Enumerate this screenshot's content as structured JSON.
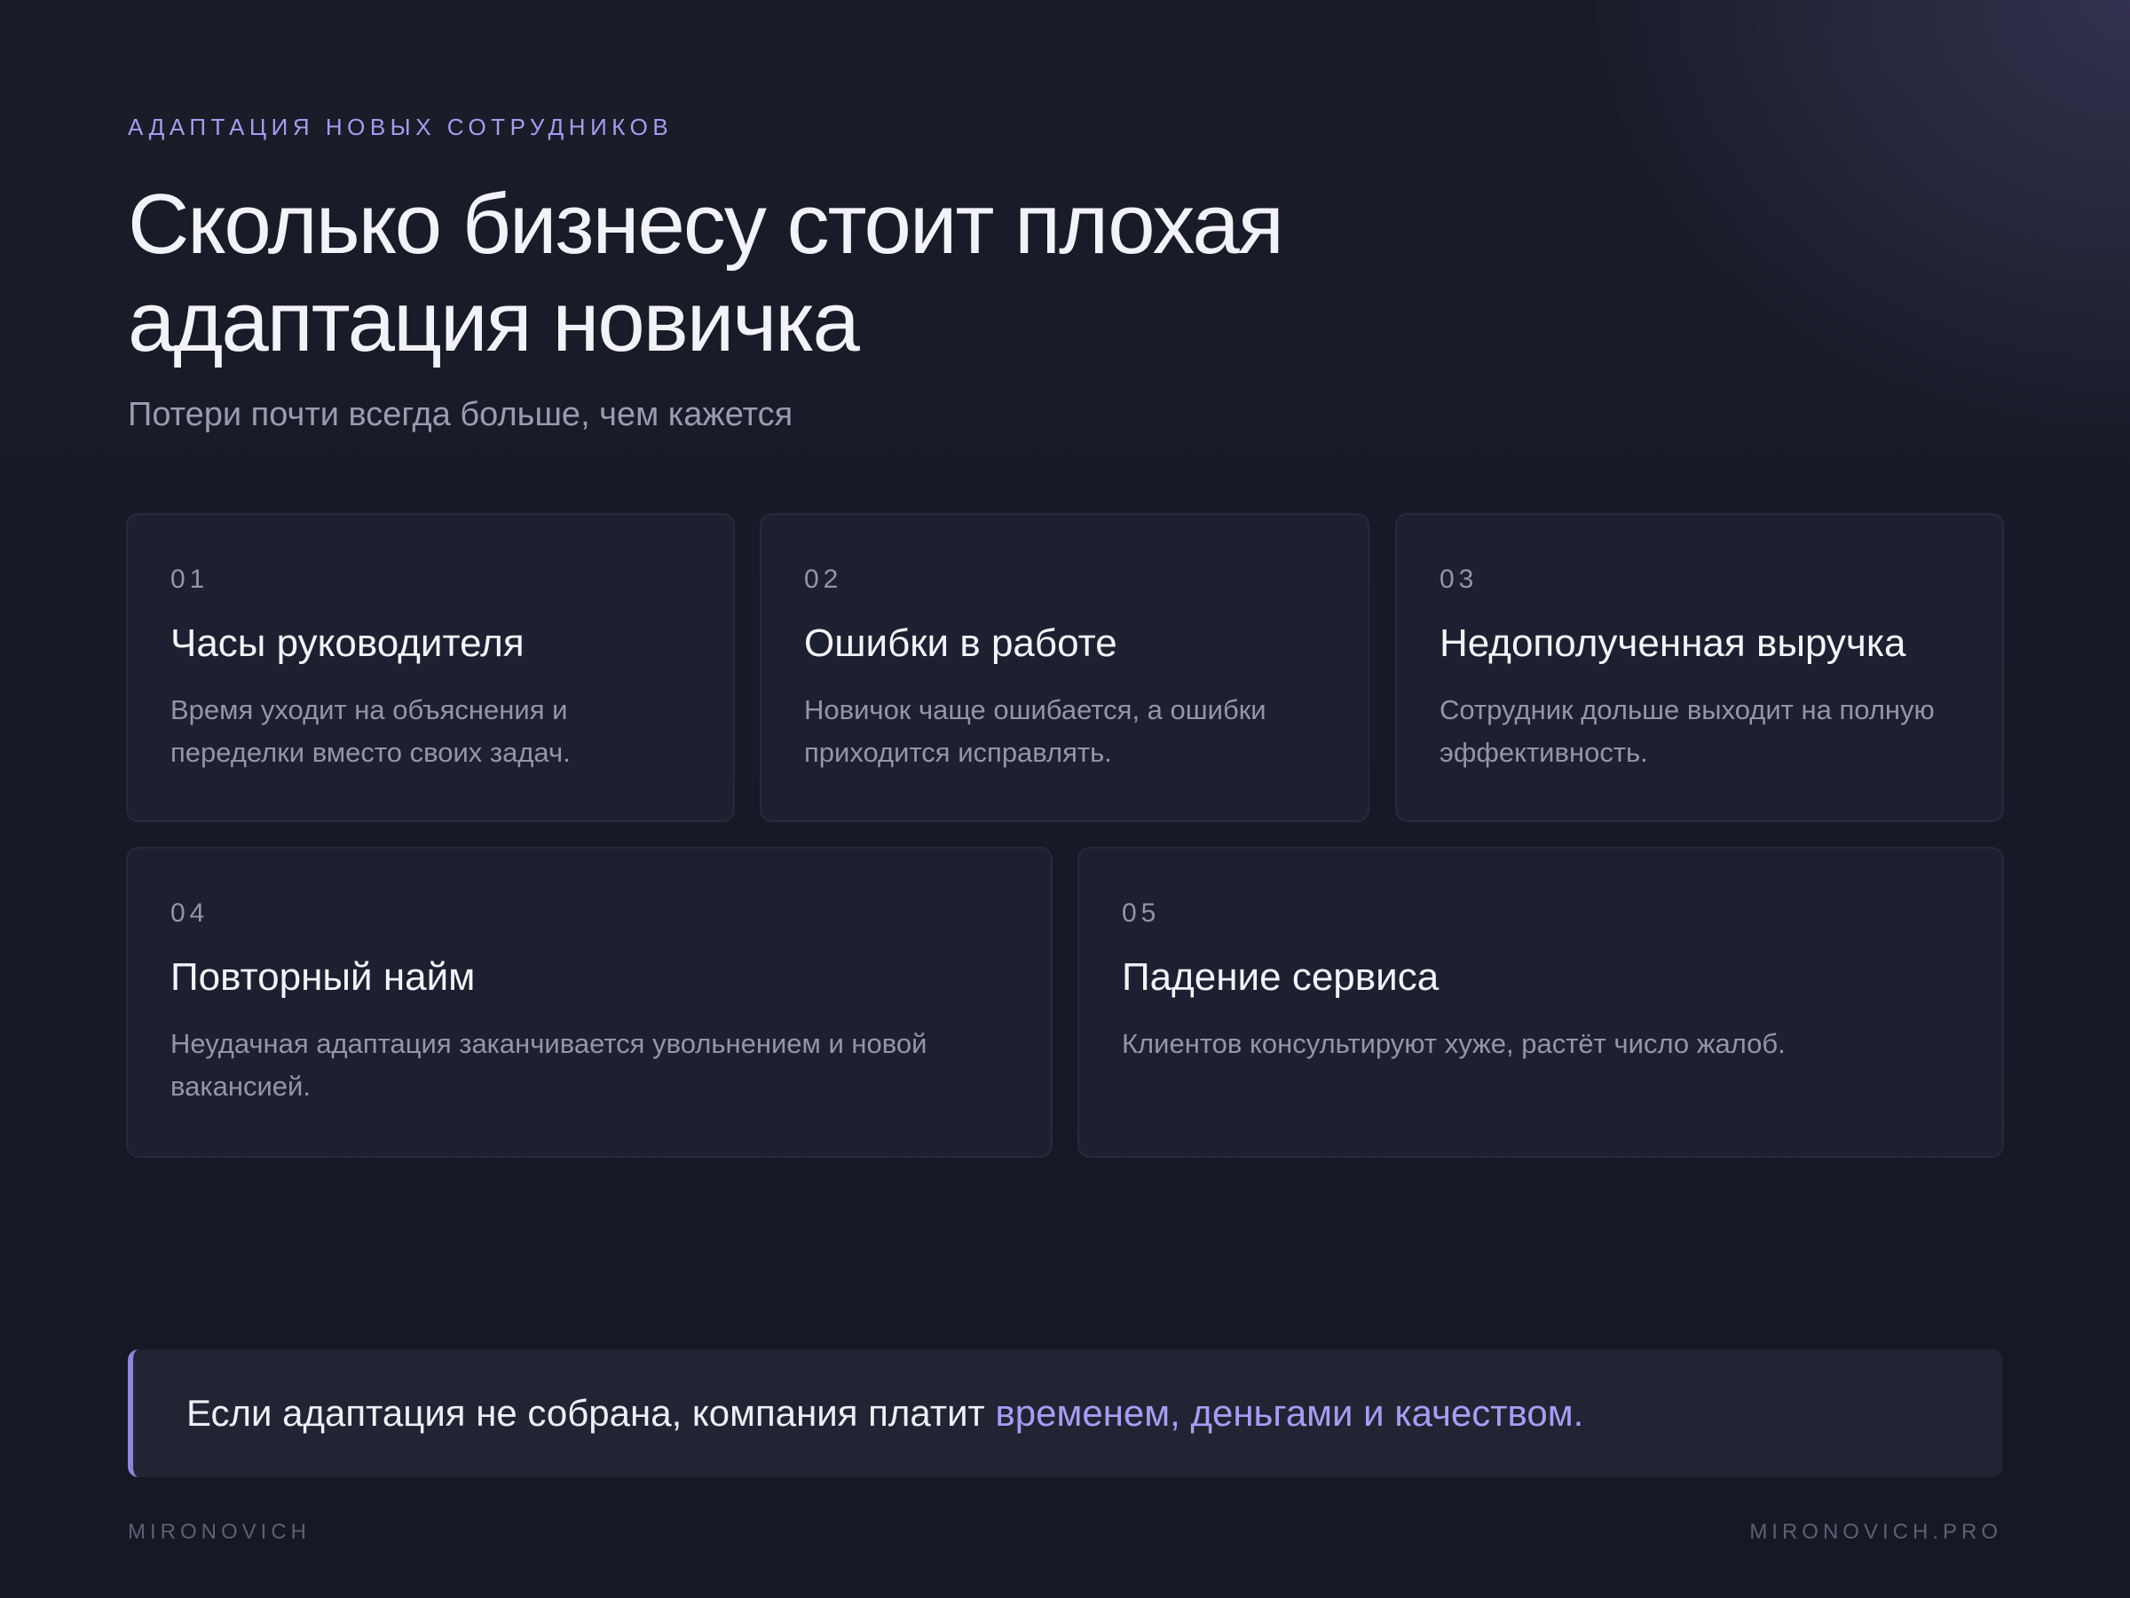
{
  "header": {
    "eyebrow": "АДАПТАЦИЯ НОВЫХ СОТРУДНИКОВ",
    "title": "Сколько бизнесу стоит плохая адаптация новичка",
    "subtitle": "Потери почти всегда больше, чем кажется"
  },
  "cards": [
    {
      "number": "01",
      "title": "Часы руководителя",
      "description": "Время уходит на объяснения и переделки вместо своих задач."
    },
    {
      "number": "02",
      "title": "Ошибки в работе",
      "description": "Новичок чаще ошибается, а ошибки приходится исправлять."
    },
    {
      "number": "03",
      "title": "Недополученная выручка",
      "description": "Сотрудник дольше выходит на полную эффективность."
    },
    {
      "number": "04",
      "title": "Повторный найм",
      "description": "Неудачная адаптация заканчивается увольнением и новой вакансией."
    },
    {
      "number": "05",
      "title": "Падение сервиса",
      "description": "Клиентов консультируют хуже, растёт число жалоб."
    }
  ],
  "callout": {
    "text": "Если адаптация не собрана, компания платит ",
    "highlight": "временем, деньгами и качеством."
  },
  "footer": {
    "left": "MIRONOVICH",
    "right": "MIRONOVICH.PRO"
  },
  "colors": {
    "background": "#171a26",
    "card": "#1d2030",
    "accent": "#a99cf4",
    "muted": "#9496a8"
  }
}
